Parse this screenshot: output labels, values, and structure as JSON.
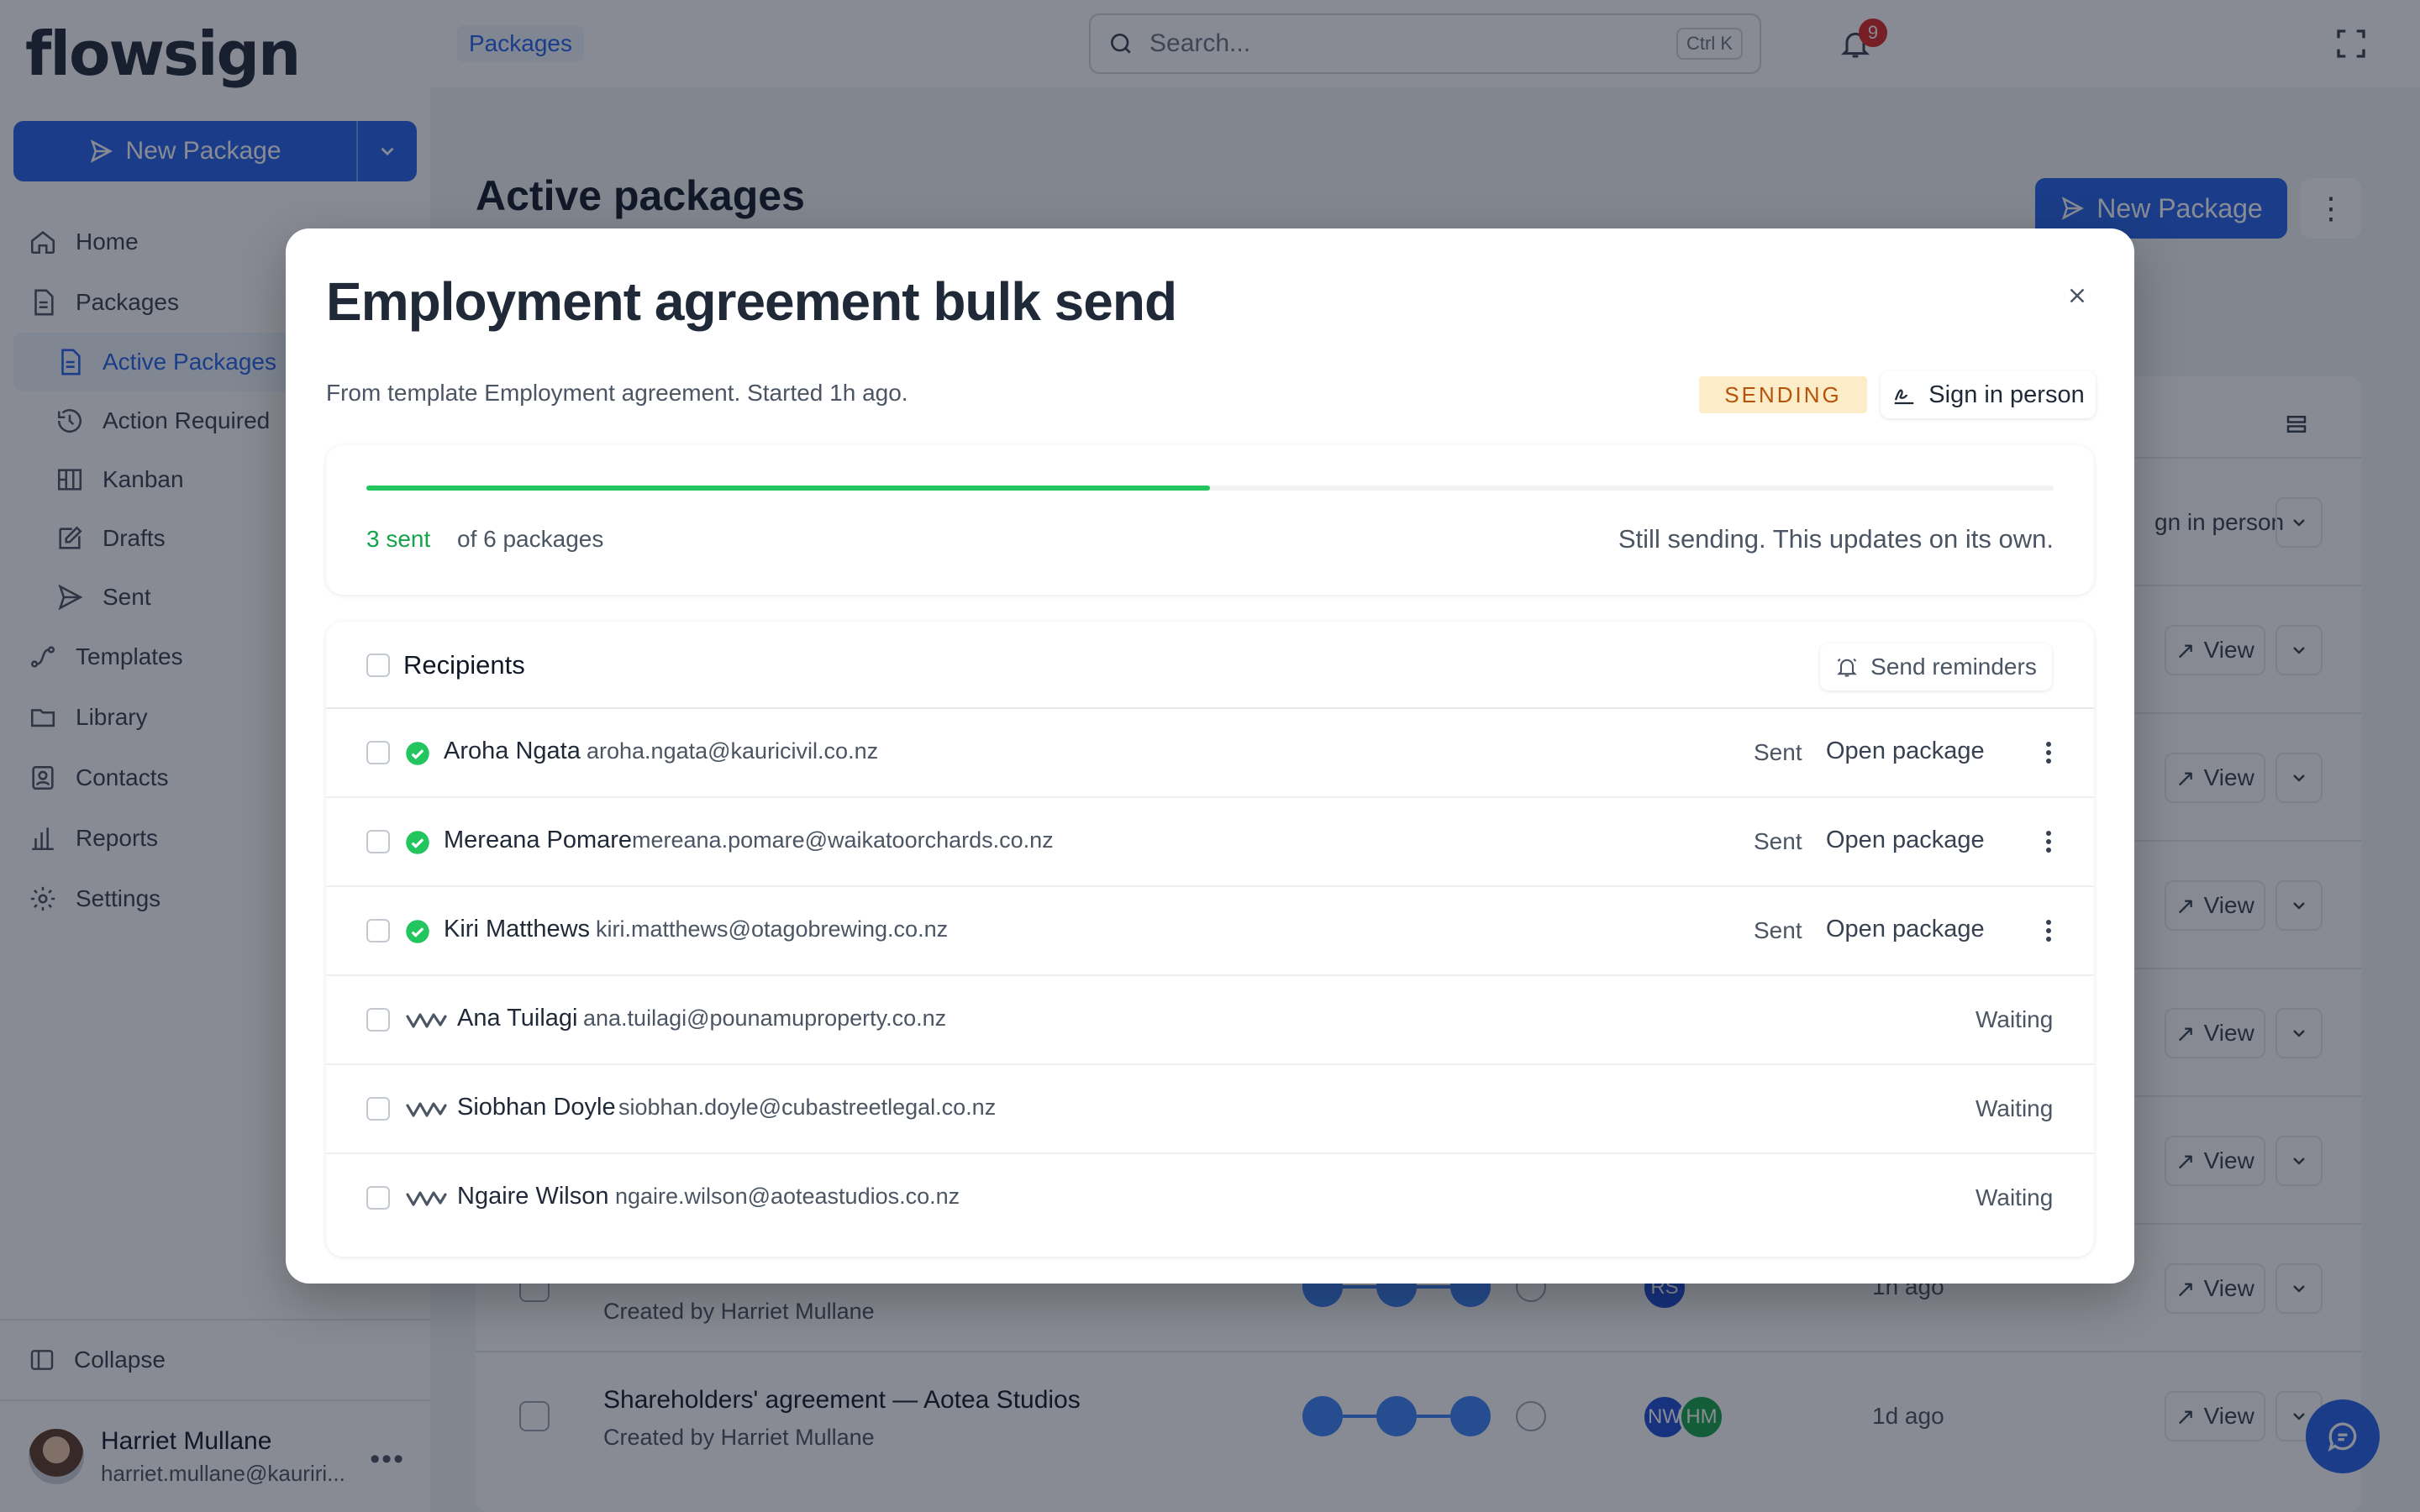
{
  "app": {
    "logo": "flowsign",
    "breadcrumb": "Packages",
    "search_placeholder": "Search...",
    "search_shortcut": "Ctrl K",
    "notification_count": "9"
  },
  "sidebar": {
    "new_package_label": "New Package",
    "items": [
      {
        "label": "Home",
        "icon": "home-icon"
      },
      {
        "label": "Packages",
        "icon": "document-icon"
      },
      {
        "label": "Active Packages",
        "icon": "document-icon",
        "sub": true,
        "active": true
      },
      {
        "label": "Action Required",
        "icon": "history-icon",
        "sub": true
      },
      {
        "label": "Kanban",
        "icon": "kanban-icon",
        "sub": true
      },
      {
        "label": "Drafts",
        "icon": "edit-icon",
        "sub": true
      },
      {
        "label": "Sent",
        "icon": "send-icon",
        "sub": true
      },
      {
        "label": "Templates",
        "icon": "route-icon"
      },
      {
        "label": "Library",
        "icon": "folder-icon"
      },
      {
        "label": "Contacts",
        "icon": "contact-icon"
      },
      {
        "label": "Reports",
        "icon": "bar-chart-icon"
      },
      {
        "label": "Settings",
        "icon": "gear-icon"
      }
    ],
    "collapse_label": "Collapse",
    "user": {
      "name": "Harriet Mullane",
      "email": "harriet.mullane@kauriri..."
    }
  },
  "background_page": {
    "title": "Active packages",
    "new_package_label": "New Package",
    "view_label": "View",
    "sign_in_person_partial": "gn in person",
    "rows": [
      {
        "title": "",
        "sub": "Created by Harriet Mullane",
        "time": "1h ago",
        "avatars": [
          "RS"
        ]
      },
      {
        "title": "Shareholders' agreement — Aotea Studios",
        "sub": "Created by Harriet Mullane",
        "time": "1d ago",
        "avatars": [
          "NW",
          "HM"
        ]
      }
    ]
  },
  "modal": {
    "title": "Employment agreement bulk send",
    "subtitle": "From template Employment agreement. Started 1h ago.",
    "status": "SENDING",
    "sign_in_person_label": "Sign in person",
    "progress": {
      "sent_label": "3 sent",
      "of_label": "of 6 packages",
      "sent": 3,
      "total": 6,
      "message": "Still sending. This updates on its own."
    },
    "recipients_label": "Recipients",
    "send_reminders_label": "Send reminders",
    "open_package_label": "Open package",
    "colors": {
      "sent": "#22c55e",
      "accent": "#2563eb",
      "badge_bg": "#fdecc8",
      "badge_fg": "#b45309"
    },
    "recipients": [
      {
        "name": "Aroha Ngata",
        "email": "aroha.ngata@kauricivil.co.nz",
        "status": "Sent"
      },
      {
        "name": "Mereana Pomare",
        "email": "mereana.pomare@waikatoorchards.co.nz",
        "status": "Sent"
      },
      {
        "name": "Kiri Matthews",
        "email": "kiri.matthews@otagobrewing.co.nz",
        "status": "Sent"
      },
      {
        "name": "Ana Tuilagi",
        "email": "ana.tuilagi@pounamuproperty.co.nz",
        "status": "Waiting"
      },
      {
        "name": "Siobhan Doyle",
        "email": "siobhan.doyle@cubastreetlegal.co.nz",
        "status": "Waiting"
      },
      {
        "name": "Ngaire Wilson",
        "email": "ngaire.wilson@aoteastudios.co.nz",
        "status": "Waiting"
      }
    ]
  }
}
